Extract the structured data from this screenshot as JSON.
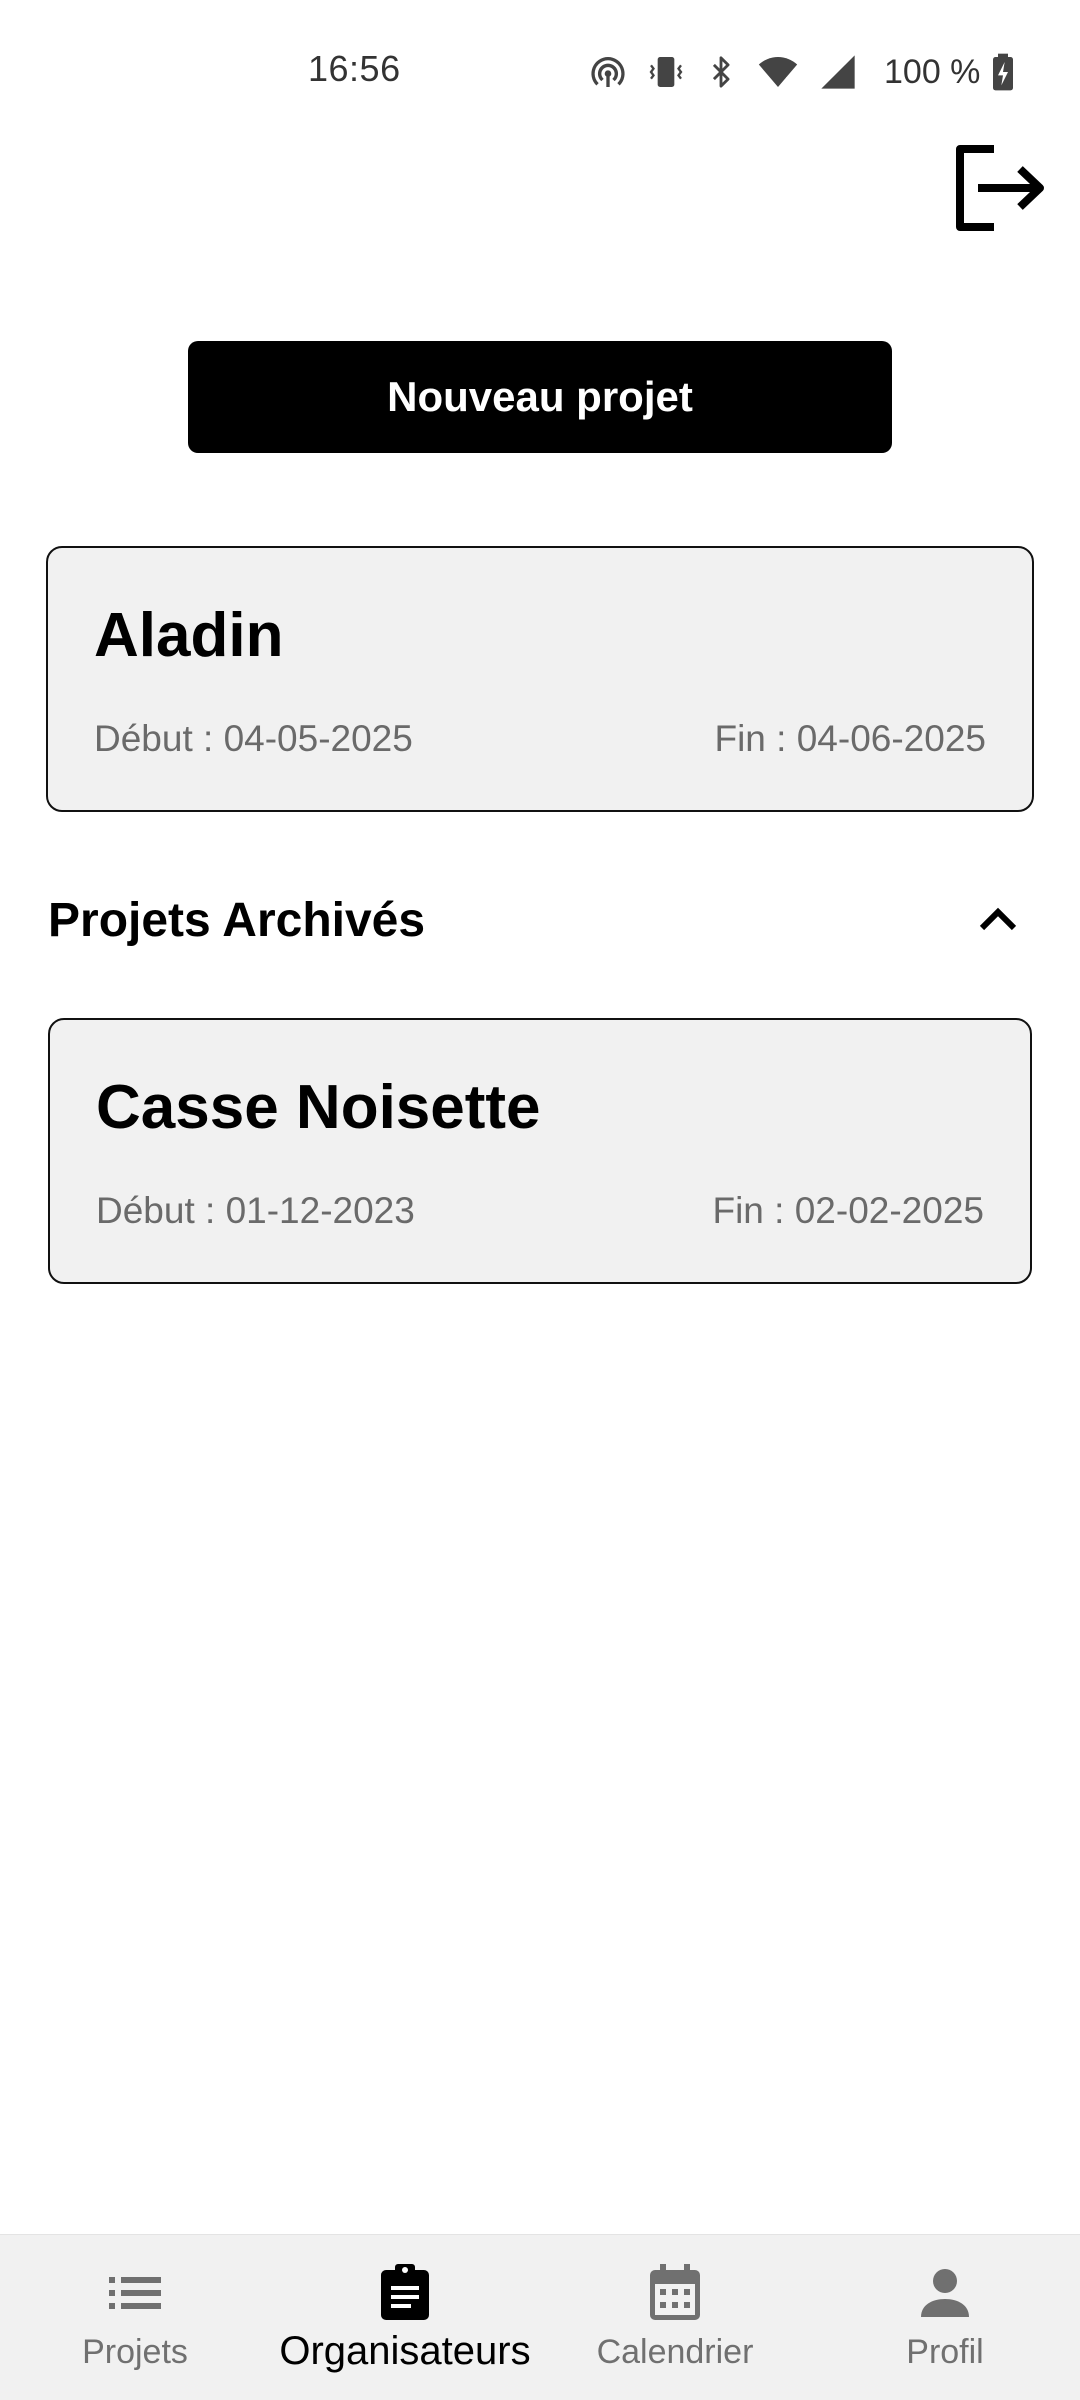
{
  "status_bar": {
    "time": "16:56",
    "battery": "100 %",
    "icons": [
      "hotspot-icon",
      "vibrate-icon",
      "bluetooth-icon",
      "wifi-icon",
      "signal-icon",
      "battery-charging-icon"
    ]
  },
  "header": {
    "logout_icon": "logout-icon"
  },
  "actions": {
    "new_project_label": "Nouveau projet"
  },
  "projects": [
    {
      "title": "Aladin",
      "start": "Début : 04-05-2025",
      "end": "Fin : 04-06-2025"
    }
  ],
  "archived": {
    "title": "Projets Archivés",
    "toggle_icon": "chevron-up-icon",
    "projects": [
      {
        "title": "Casse Noisette",
        "start": "Début : 01-12-2023",
        "end": "Fin : 02-02-2025"
      }
    ]
  },
  "bottom_nav": {
    "items": [
      {
        "label": "Projets",
        "icon": "list-icon",
        "active": false
      },
      {
        "label": "Organisateurs",
        "icon": "clipboard-icon",
        "active": true
      },
      {
        "label": "Calendrier",
        "icon": "calendar-icon",
        "active": false
      },
      {
        "label": "Profil",
        "icon": "person-icon",
        "active": false
      }
    ]
  },
  "colors": {
    "primary": "#000000",
    "card_background": "#f1f1f1",
    "muted_text": "#6a6a6a",
    "nav_background": "#f1f1f1"
  }
}
